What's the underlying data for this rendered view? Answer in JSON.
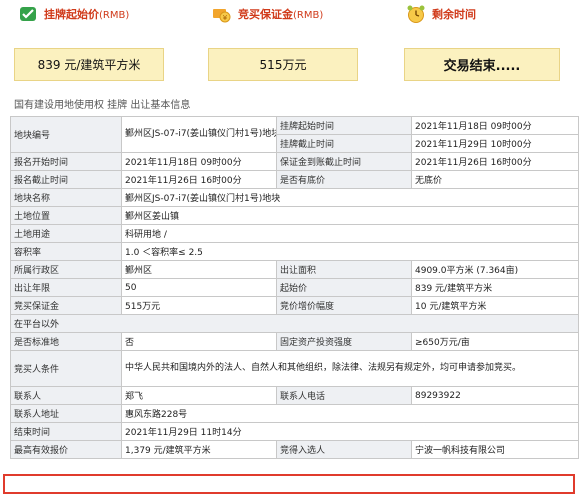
{
  "summary": {
    "start_price": {
      "title": "挂牌起始价",
      "unit": "(RMB)",
      "value": "839 元/建筑平方米"
    },
    "deposit": {
      "title": "竞买保证金",
      "unit": "(RMB)",
      "value": "515万元"
    },
    "remaining": {
      "title": "剩余时间",
      "value": "交易结束....."
    }
  },
  "section_title": "国有建设用地使用权 挂牌 出让基本信息",
  "fields": {
    "parcel_no": {
      "label": "地块编号",
      "value": "鄞州区JS-07-i7(姜山镇仪门村1号)地块"
    },
    "listing_start": {
      "label": "挂牌起始时间",
      "value": "2021年11月18日 09时00分"
    },
    "listing_end": {
      "label": "挂牌截止时间",
      "value": "2021年11月29日 10时00分"
    },
    "signup_start": {
      "label": "报名开始时间",
      "value": "2021年11月18日 09时00分"
    },
    "deposit_deadline": {
      "label": "保证金到账截止时间",
      "value": "2021年11月26日 16时00分"
    },
    "signup_end": {
      "label": "报名截止时间",
      "value": "2021年11月26日 16时00分"
    },
    "reserve": {
      "label": "是否有底价",
      "value": "无底价"
    },
    "parcel_name": {
      "label": "地块名称",
      "value": "鄞州区JS-07-i7(姜山镇仪门村1号)地块"
    },
    "location": {
      "label": "土地位置",
      "value": "鄞州区姜山镇"
    },
    "usage": {
      "label": "土地用途",
      "value": "科研用地 /"
    },
    "far": {
      "label": "容积率",
      "value": "1.0 ＜容积率≤ 2.5"
    },
    "district": {
      "label": "所属行政区",
      "value": "鄞州区"
    },
    "area": {
      "label": "出让面积",
      "value": "4909.0平方米 (7.364亩)"
    },
    "term": {
      "label": "出让年限",
      "value": "50"
    },
    "start_price": {
      "label": "起始价",
      "value": "839 元/建筑平方米"
    },
    "bid_deposit": {
      "label": "竞买保证金",
      "value": "515万元"
    },
    "increment": {
      "label": "竞价增价幅度",
      "value": "10 元/建筑平方米"
    },
    "platform": {
      "label": "在平台以外"
    },
    "standard": {
      "label": "是否标准地",
      "value": "否"
    },
    "fixed_asset": {
      "label": "固定资产投资强度",
      "value": "≥650万元/亩"
    },
    "conditions": {
      "label": "竞买人条件",
      "value": "中华人民共和国境内外的法人、自然人和其他组织，除法律、法规另有规定外，均可申请参加竞买。"
    },
    "contact": {
      "label": "联系人",
      "value": "郑飞"
    },
    "phone": {
      "label": "联系人电话",
      "value": "89293922"
    },
    "address": {
      "label": "联系人地址",
      "value": "惠风东路228号"
    },
    "end_time": {
      "label": "结束时间",
      "value": "2021年11月29日 11时14分"
    },
    "top_bid": {
      "label": "最高有效报价",
      "value": "1,379 元/建筑平方米"
    },
    "winner": {
      "label": "竞得入选人",
      "value": "宁波一帆科技有限公司"
    }
  },
  "colors": {
    "accent": "#d03a1a",
    "box_bg": "#fbf1bf",
    "label_bg": "#eef0f3",
    "highlight": "#e03b2c"
  },
  "icons": [
    "price-tag-icon",
    "money-coins-icon",
    "alarm-clock-icon"
  ]
}
